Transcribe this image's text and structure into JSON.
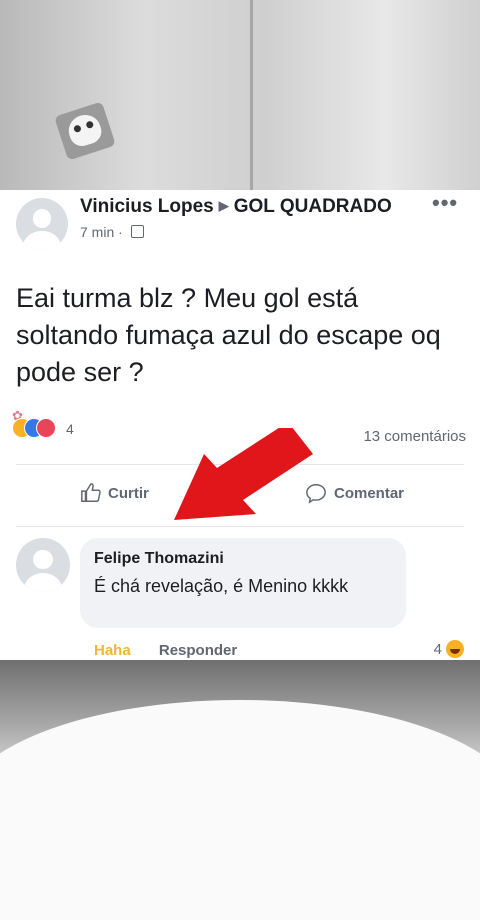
{
  "post": {
    "author": "Vinicius Lopes",
    "group": "GOL QUADRADO",
    "time": "7 min",
    "separator": "·",
    "more": "•••",
    "text": "Eai turma blz ? Meu gol está soltando fumaça azul do escape oq pode ser ?",
    "reaction_count": "4",
    "comments_count": "13 comentários"
  },
  "actions": {
    "like": "Curtir",
    "comment": "Comentar"
  },
  "comment": {
    "name": "Felipe Thomazini",
    "text": "É chá revelação, é Menino kkkk",
    "haha_label": "Haha",
    "reply_label": "Responder",
    "reaction_count": "4"
  },
  "icons": [
    "skull-sticker-icon",
    "more-options-icon",
    "globe-icon",
    "like-icon",
    "comment-icon",
    "haha-reaction-icon",
    "red-arrow-icon"
  ],
  "colors": {
    "accent_red": "#e0161b",
    "haha": "#f0b53d",
    "text": "#1c1e21",
    "muted": "#606770"
  }
}
